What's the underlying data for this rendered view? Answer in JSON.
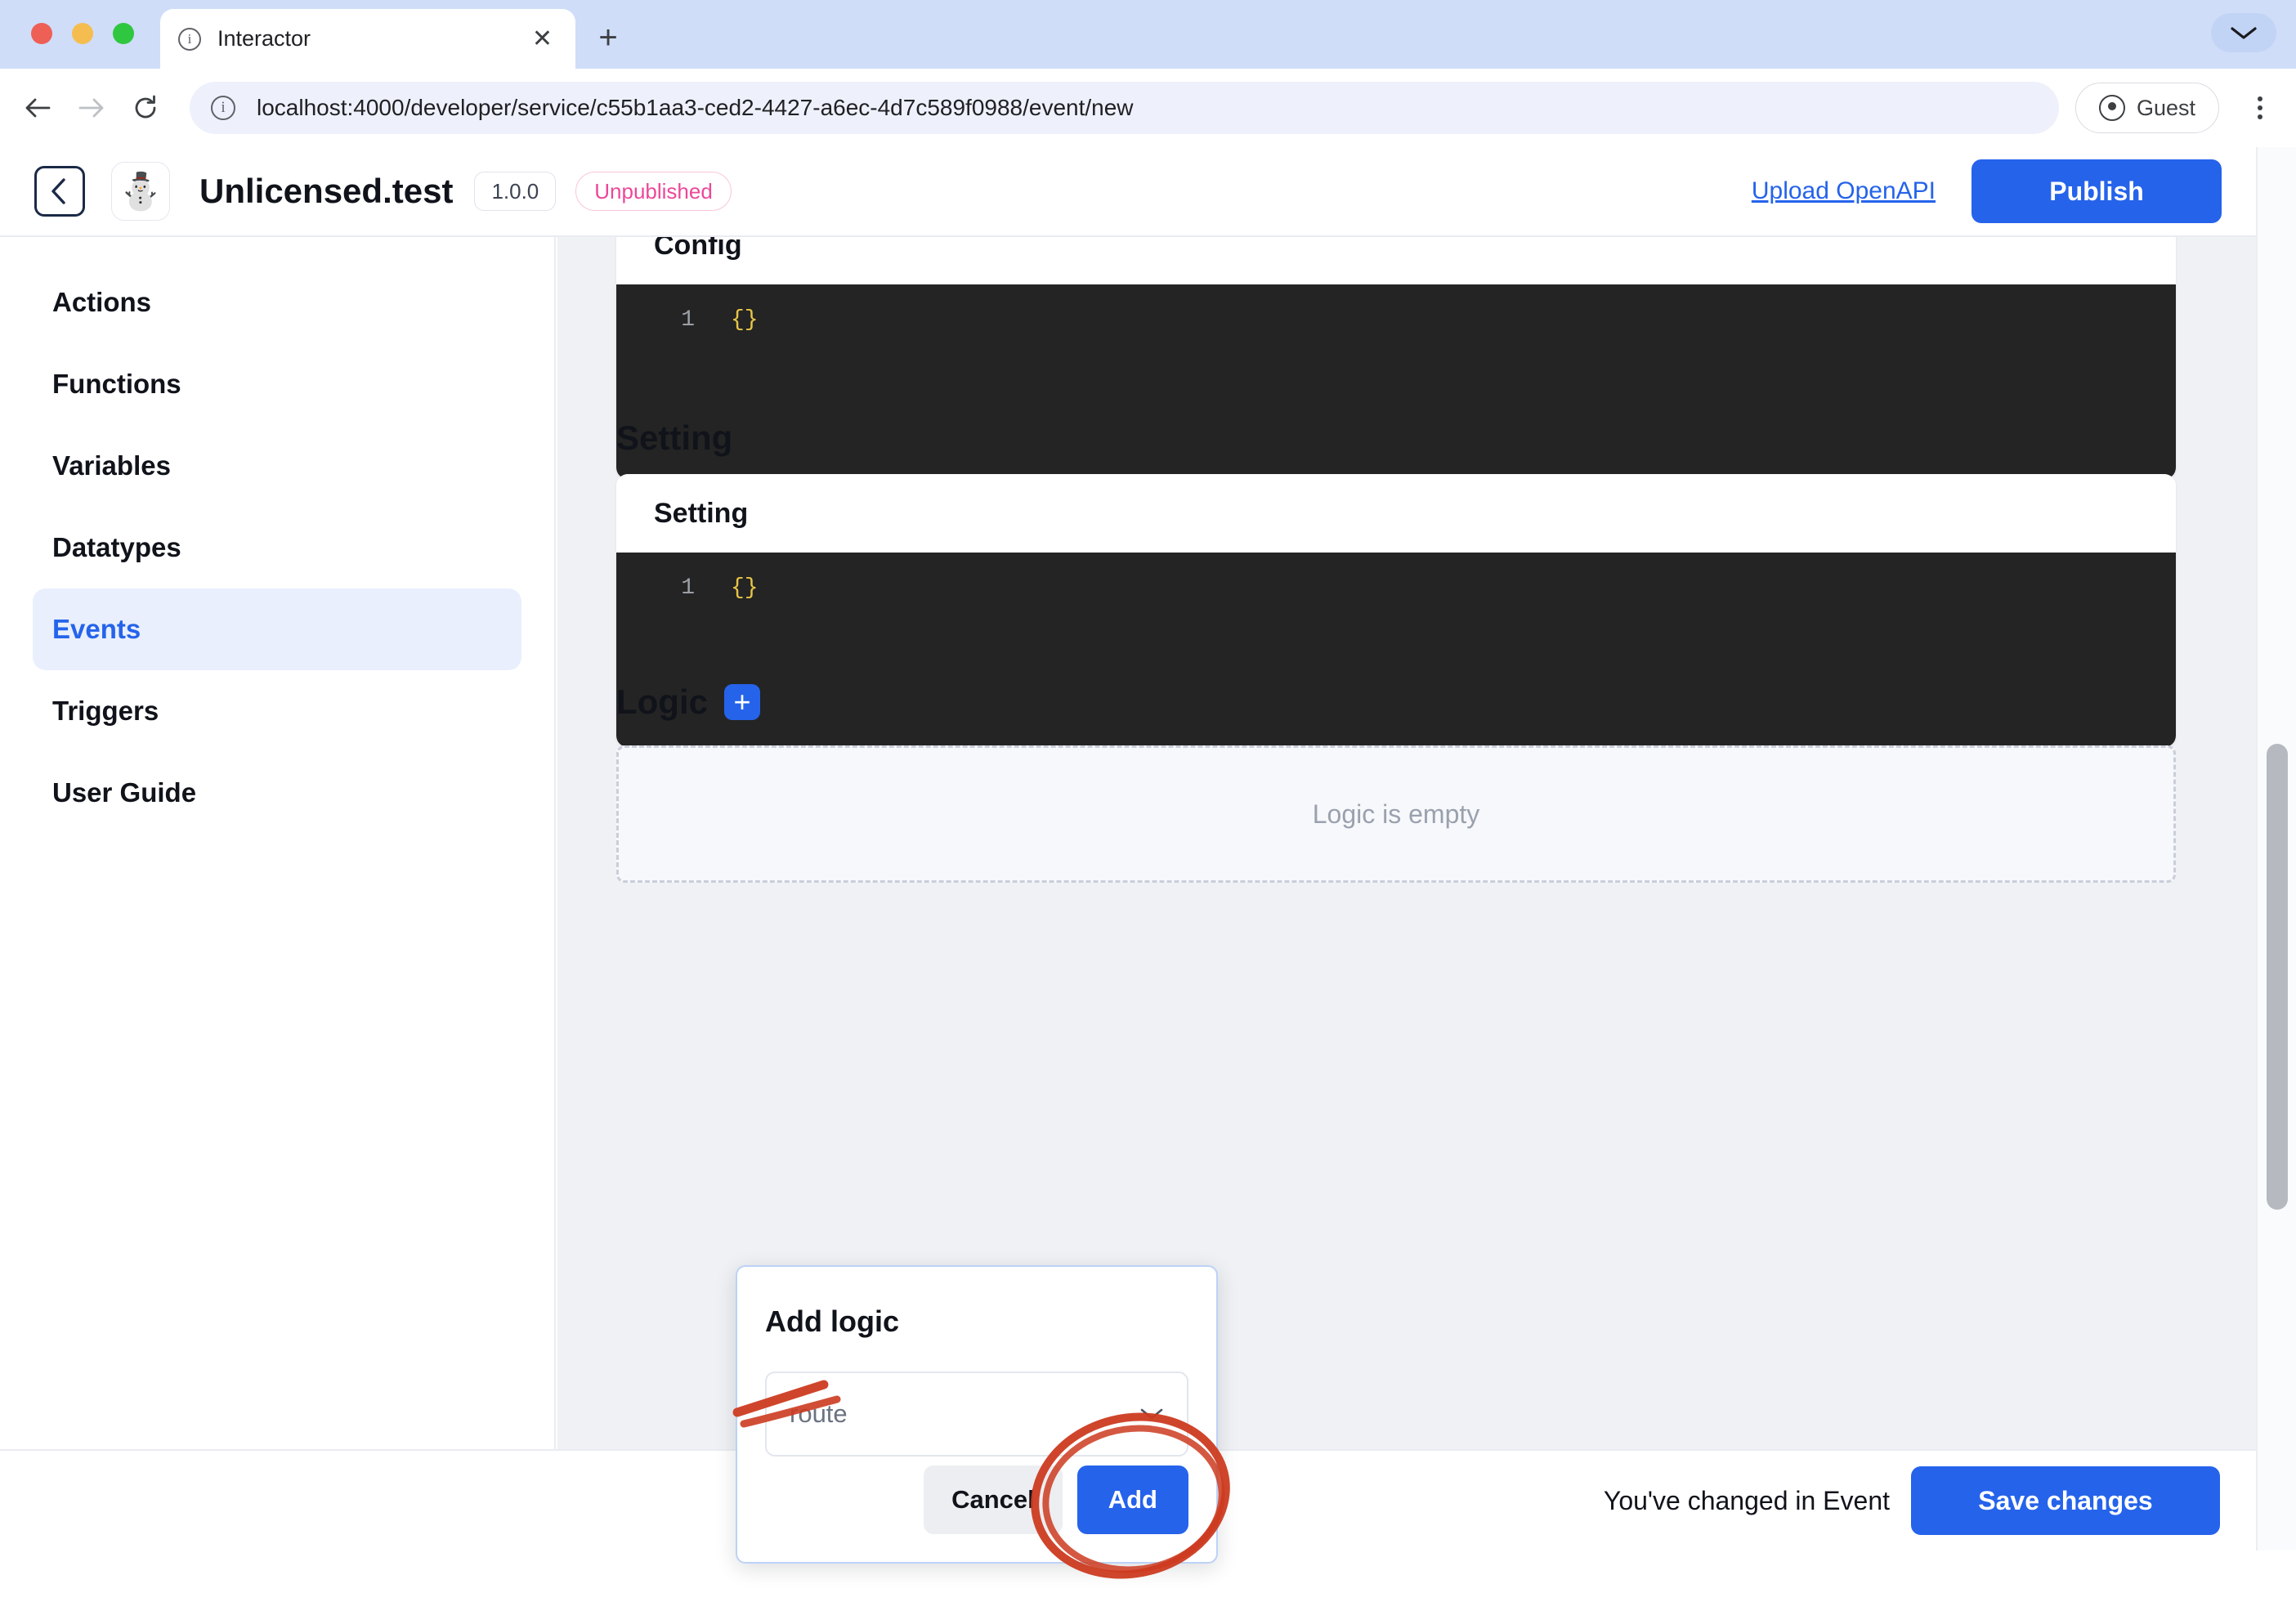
{
  "browser": {
    "tab": {
      "title": "Interactor",
      "favicon_icon": "info-circle-icon",
      "close_icon": "close-icon"
    },
    "new_tab_icon": "plus-icon",
    "tabstrip_chevron_icon": "chevron-down-icon",
    "back_icon": "arrow-left-icon",
    "forward_icon": "arrow-right-icon",
    "reload_icon": "reload-icon",
    "url": "localhost:4000/developer/service/c55b1aa3-ced2-4427-a6ec-4d7c589f0988/event/new",
    "site_info_icon": "info-circle-icon",
    "profile": {
      "label": "Guest",
      "icon": "account-circle-icon"
    },
    "menu_icon": "kebab-menu-icon"
  },
  "header": {
    "back_icon": "chevron-left-icon",
    "logo_icon": "snowman-logo",
    "logo_glyph": "⛄",
    "title": "Unlicensed.test",
    "version": "1.0.0",
    "status": "Unpublished",
    "upload_link": "Upload OpenAPI",
    "publish_label": "Publish"
  },
  "sidebar": {
    "items": [
      {
        "label": "Actions",
        "active": false
      },
      {
        "label": "Functions",
        "active": false
      },
      {
        "label": "Variables",
        "active": false
      },
      {
        "label": "Datatypes",
        "active": false
      },
      {
        "label": "Events",
        "active": true
      },
      {
        "label": "Triggers",
        "active": false
      },
      {
        "label": "User Guide",
        "active": false
      }
    ]
  },
  "main": {
    "config": {
      "card_title": "Config",
      "code_line_number": "1",
      "code_text": "{}"
    },
    "setting": {
      "section_title": "Setting",
      "card_title": "Setting",
      "code_line_number": "1",
      "code_text": "{}"
    },
    "logic": {
      "section_title": "Logic",
      "add_icon": "plus-icon",
      "empty_text": "Logic is empty"
    }
  },
  "modal": {
    "title": "Add logic",
    "select_value": "route",
    "select_chevron_icon": "chevron-down-icon",
    "cancel_label": "Cancel",
    "add_label": "Add"
  },
  "footer": {
    "message": "You've changed in Event",
    "save_label": "Save changes"
  },
  "annotations": {
    "color": "#cc3b20",
    "marks": [
      "underline-under-route-select",
      "circle-around-add-button"
    ]
  },
  "colors": {
    "accent_blue": "#2563eb",
    "status_pink": "#ec4899",
    "code_bg": "#242424",
    "code_token": "#e7c547",
    "canvas": "#eff1f5"
  }
}
